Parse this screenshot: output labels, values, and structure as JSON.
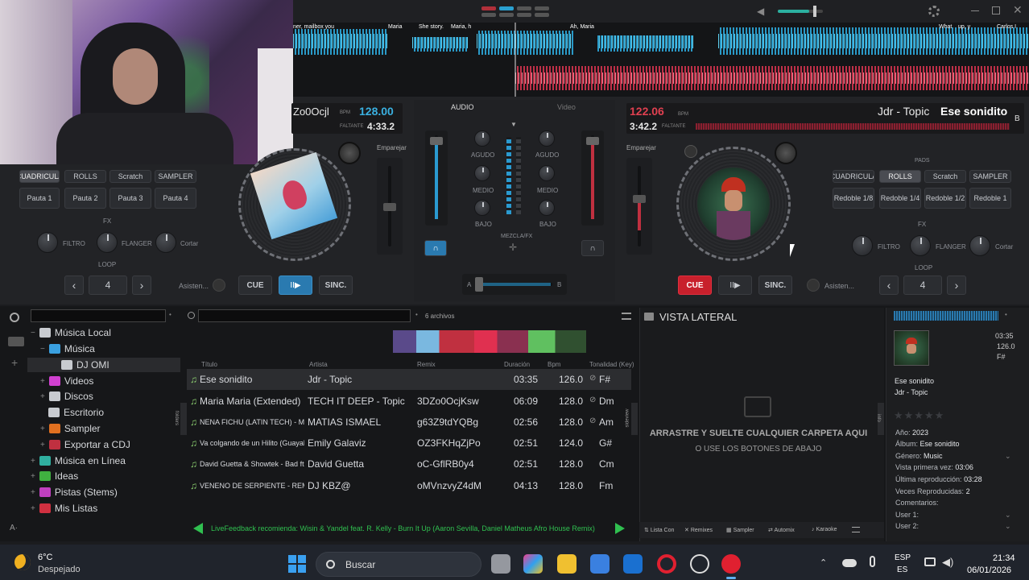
{
  "deck_left": {
    "title_partial": "Zo0Ocjl",
    "bpm": "128.00",
    "bpm_label": "BPM",
    "remaining": "4:33.2",
    "remaining_label": "FALTANTE",
    "match_label": "Emparejar",
    "pad_tabs": [
      "CUADRICULA",
      "ROLLS",
      "Scratch",
      "SAMPLER"
    ],
    "pads": [
      "Pauta 1",
      "Pauta 2",
      "Pauta 3",
      "Pauta 4"
    ],
    "fx_label": "FX",
    "fx": [
      "FILTRO",
      "FLANGER",
      "Cortar"
    ],
    "loop_label": "LOOP",
    "loop_value": "4",
    "assist_label": "Asisten...",
    "cue": "CUE",
    "sync": "SINC."
  },
  "deck_right": {
    "bpm": "122.06",
    "bpm_label": "BPM",
    "remaining": "3:42.2",
    "remaining_label": "FALTANTE",
    "artist": "Jdr - Topic",
    "title": "Ese sonidito",
    "deck_letter": "B",
    "match_label": "Emparejar",
    "pads_label": "PADS",
    "pad_tabs": [
      "CUADRICULA",
      "ROLLS",
      "Scratch",
      "SAMPLER"
    ],
    "pads": [
      "Redoble 1/8",
      "Redoble 1/4",
      "Redoble 1/2",
      "Redoble 1"
    ],
    "fx_label": "FX",
    "fx": [
      "FILTRO",
      "FLANGER",
      "Cortar"
    ],
    "loop_label": "LOOP",
    "loop_value": "4",
    "assist_label": "Asisten...",
    "cue": "CUE",
    "sync": "SINC."
  },
  "mixer": {
    "tab_audio": "AUDIO",
    "tab_video": "Video",
    "eq_left": [
      "AGUDO",
      "MEDIO",
      "BAJO"
    ],
    "eq_right": [
      "AGUDO",
      "MEDIO",
      "BAJO"
    ],
    "master_label": "MEZCLA/FX",
    "crossfader_a": "A",
    "crossfader_b": "B"
  },
  "waveform": {
    "labels": [
      "ner, mailbox you",
      "Maria",
      "She story.",
      "Maria, h",
      "Ah, Maria",
      "What",
      "up, y",
      "Carlos I"
    ]
  },
  "browser": {
    "file_count": "6 archivos",
    "folders_tab": "folders",
    "sideview_tab": "sideview",
    "info_tab": "info",
    "tree": [
      {
        "label": "Música Local",
        "color": "#c8cbd0"
      },
      {
        "label": "Música",
        "color": "#3aa0e0"
      },
      {
        "label": "DJ OMI",
        "color": "#c8cbd0"
      },
      {
        "label": "Videos",
        "color": "#d040d0"
      },
      {
        "label": "Discos",
        "color": "#c8cbd0"
      },
      {
        "label": "Escritorio",
        "color": "#c8cbd0"
      },
      {
        "label": "Sampler",
        "color": "#e07020"
      },
      {
        "label": "Exportar a CDJ",
        "color": "#c03040"
      },
      {
        "label": "Música en Línea",
        "color": "#30b0a0"
      },
      {
        "label": "Ideas",
        "color": "#40b040"
      },
      {
        "label": "Pistas (Stems)",
        "color": "#c040c0"
      },
      {
        "label": "Mis Listas",
        "color": "#d03040"
      }
    ],
    "columns": [
      "Título",
      "Artista",
      "Remix",
      "Duración",
      "Bpm",
      "Tonalidad (Key)"
    ],
    "tracks": [
      {
        "title": "Ese sonidito",
        "artist": "Jdr - Topic",
        "remix": "",
        "duration": "03:35",
        "bpm": "126.0",
        "key": "F#"
      },
      {
        "title": "Maria Maria (Extended)",
        "artist": "TECH IT DEEP - Topic",
        "remix": "3DZo0OcjKsw",
        "duration": "06:09",
        "bpm": "128.0",
        "key": "Dm"
      },
      {
        "title": "NENA FICHU (LATIN TECH) - Mati...",
        "artist": "MATIAS ISMAEL",
        "remix": "g63Z9tdYQBg",
        "duration": "02:56",
        "bpm": "128.0",
        "key": "Am"
      },
      {
        "title": "Va colgando de un Hilito (Guayabo...",
        "artist": "Emily Galaviz",
        "remix": "OZ3FKHqZjPo",
        "duration": "02:51",
        "bpm": "124.0",
        "key": "G#"
      },
      {
        "title": "David Guetta & Showtek - Bad ft.V...",
        "artist": "David Guetta",
        "remix": "oC-GflRB0y4",
        "duration": "02:51",
        "bpm": "128.0",
        "key": "Cm"
      },
      {
        "title": "VENENO DE SERPIENTE - REMI...",
        "artist": "DJ KBZ@",
        "remix": "oMVnzvyZ4dM",
        "duration": "04:13",
        "bpm": "128.0",
        "key": "Fm"
      }
    ],
    "feedback": "LiveFeedback recomienda: Wisin & Yandel feat. R. Kelly - Burn It Up (Aaron Sevilla, Daniel Matheus Afro House Remix)"
  },
  "side_view": {
    "title": "VISTA LATERAL",
    "drop_line1": "ARRASTRE Y SUELTE CUALQUIER CARPETA AQUI",
    "drop_line2": "O USE LOS BOTONES DE ABAJO",
    "tabs": [
      "Lista Con",
      "Remixes",
      "Sampler",
      "Automix",
      "Karaoke"
    ]
  },
  "info_panel": {
    "duration": "03:35",
    "bpm": "126.0",
    "key": "F#",
    "title": "Ese sonidito",
    "artist": "Jdr - Topic",
    "props": [
      {
        "k": "Año:",
        "v": "2023"
      },
      {
        "k": "Álbum:",
        "v": "Ese sonidito"
      },
      {
        "k": "Género:",
        "v": "Music"
      },
      {
        "k": "Vista primera vez:",
        "v": "03:06"
      },
      {
        "k": "Última reproducción:",
        "v": "03:28"
      },
      {
        "k": "Veces Reproducidas:",
        "v": "2"
      },
      {
        "k": "Comentarios:",
        "v": ""
      },
      {
        "k": "User 1:",
        "v": ""
      },
      {
        "k": "User 2:",
        "v": ""
      }
    ]
  },
  "taskbar": {
    "weather_temp": "6°C",
    "weather_desc": "Despejado",
    "search": "Buscar",
    "lang1": "ESP",
    "lang2": "ES",
    "time": "21:34",
    "date": "06/01/2026"
  }
}
